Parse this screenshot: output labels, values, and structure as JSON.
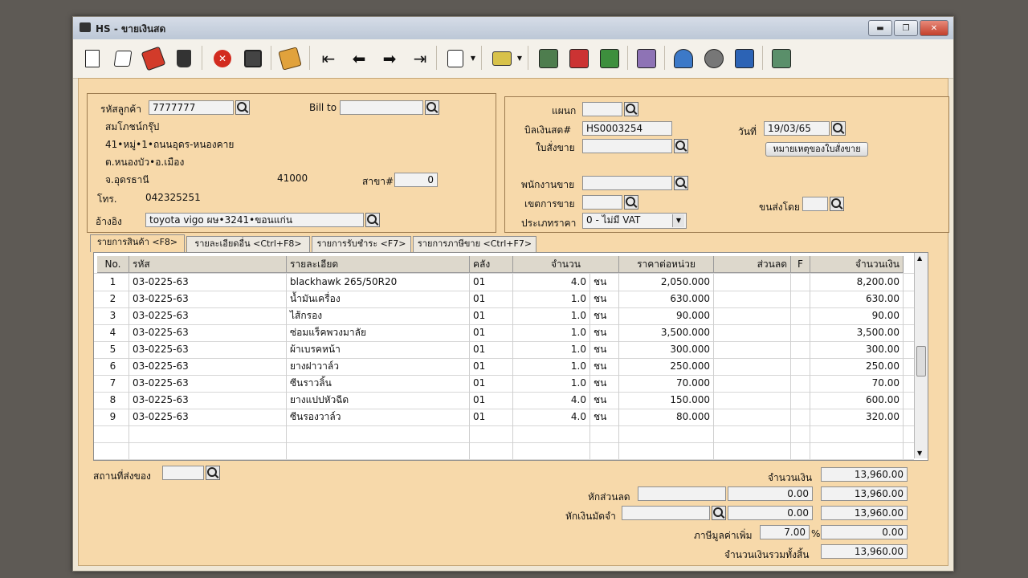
{
  "window": {
    "title": "HS - ขายเงินสด"
  },
  "titlebar_buttons": {
    "minimize": "▬",
    "maximize": "❐",
    "close": "✕"
  },
  "toolbar": {
    "icons": [
      "new-document-icon",
      "edit-icon",
      "edit-red-icon",
      "delete-bin-icon",
      "cancel-icon",
      "save-icon",
      "stamp-icon",
      "first-record-icon",
      "previous-record-icon",
      "next-record-icon",
      "last-record-icon",
      "search-document-icon",
      "print-icon",
      "report-icon",
      "window-icon",
      "spreadsheet-icon",
      "document-list-icon",
      "approve-icon",
      "ok-icon",
      "ok-blue-icon",
      "export-icon"
    ]
  },
  "customer": {
    "code_label": "รหัสลูกค้า",
    "code_value": "7777777",
    "bill_to_label": "Bill to",
    "bill_to_value": "",
    "name": "สมโภชน์กรุ๊ป",
    "address1": "41•หมู่•1•ถนนอุดร-หนองคาย",
    "address2": "ต.หนองบัว•อ.เมือง",
    "province": "จ.อุดรธานี",
    "postcode": "41000",
    "branch_label": "สาขา#",
    "branch_value": "0",
    "phone_label": "โทร.",
    "phone_value": "042325251",
    "ref_label": "อ้างอิง",
    "ref_value": "toyota vigo ผษ•3241•ขอนแก่น"
  },
  "doc": {
    "dept_label": "แผนก",
    "dept_value": "",
    "bill_label": "บิลเงินสด#",
    "bill_value": "HS0003254",
    "date_label": "วันที่",
    "date_value": "19/03/65",
    "order_label": "ใบสั่งขาย",
    "order_value": "",
    "order_note_button": "หมายเหตุของใบสั่งขาย",
    "sales_label": "พนักงานขาย",
    "sales_value": "",
    "zone_label": "เขตการขาย",
    "zone_value": "",
    "ship_label": "ขนส่งโดย",
    "ship_value": "",
    "price_type_label": "ประเภทราคา",
    "price_type_value": "0 - ไม่มี VAT"
  },
  "tabs": [
    {
      "label": "รายการสินค้า <F8>"
    },
    {
      "label": "รายละเอียดอื่น <Ctrl+F8>"
    },
    {
      "label": "รายการรับชำระ <F7>"
    },
    {
      "label": "รายการภาษีขาย <Ctrl+F7>"
    }
  ],
  "grid": {
    "headers": [
      "No.",
      "รหัส",
      "รายละเอียด",
      "คลัง",
      "จำนวน",
      "",
      "ราคาต่อหน่วย",
      "ส่วนลด",
      "F",
      "จำนวนเงิน"
    ],
    "rows": [
      [
        "1",
        "03-0225-63",
        "blackhawk 265/50R20",
        "01",
        "4.0",
        "ชน",
        "2,050.000",
        "",
        "",
        "8,200.00"
      ],
      [
        "2",
        "03-0225-63",
        "น้ำมันเครื่อง",
        "01",
        "1.0",
        "ชน",
        "630.000",
        "",
        "",
        "630.00"
      ],
      [
        "3",
        "03-0225-63",
        "ไส้กรอง",
        "01",
        "1.0",
        "ชน",
        "90.000",
        "",
        "",
        "90.00"
      ],
      [
        "4",
        "03-0225-63",
        "ซ่อมแร็คพวงมาลัย",
        "01",
        "1.0",
        "ชน",
        "3,500.000",
        "",
        "",
        "3,500.00"
      ],
      [
        "5",
        "03-0225-63",
        "ผ้าเบรคหน้า",
        "01",
        "1.0",
        "ชน",
        "300.000",
        "",
        "",
        "300.00"
      ],
      [
        "6",
        "03-0225-63",
        "ยางฝาวาล์ว",
        "01",
        "1.0",
        "ชน",
        "250.000",
        "",
        "",
        "250.00"
      ],
      [
        "7",
        "03-0225-63",
        "ซีนราวลิ้น",
        "01",
        "1.0",
        "ชน",
        "70.000",
        "",
        "",
        "70.00"
      ],
      [
        "8",
        "03-0225-63",
        "ยางแปปหัวฉีด",
        "01",
        "4.0",
        "ชน",
        "150.000",
        "",
        "",
        "600.00"
      ],
      [
        "9",
        "03-0225-63",
        "ซีนรองวาล์ว",
        "01",
        "4.0",
        "ชน",
        "80.000",
        "",
        "",
        "320.00"
      ],
      [
        "",
        "",
        "",
        "",
        "",
        "",
        "",
        "",
        "",
        ""
      ],
      [
        "",
        "",
        "",
        "",
        "",
        "",
        "",
        "",
        "",
        ""
      ]
    ]
  },
  "footer": {
    "delivery_place_label": "สถานที่ส่งของ",
    "delivery_place_value": "",
    "amount_label": "จำนวนเงิน",
    "amount_value": "13,960.00",
    "discount_label": "หักส่วนลด",
    "discount_text": "",
    "discount_value": "0.00",
    "discount_result": "13,960.00",
    "deposit_label": "หักเงินมัดจำ",
    "deposit_text": "",
    "deposit_value": "0.00",
    "deposit_result": "13,960.00",
    "vat_label": "ภาษีมูลค่าเพิ่ม",
    "vat_rate": "7.00",
    "vat_pct": "%",
    "vat_value": "0.00",
    "total_label": "จำนวนเงินรวมทั้งสิ้น",
    "total_value": "13,960.00"
  }
}
